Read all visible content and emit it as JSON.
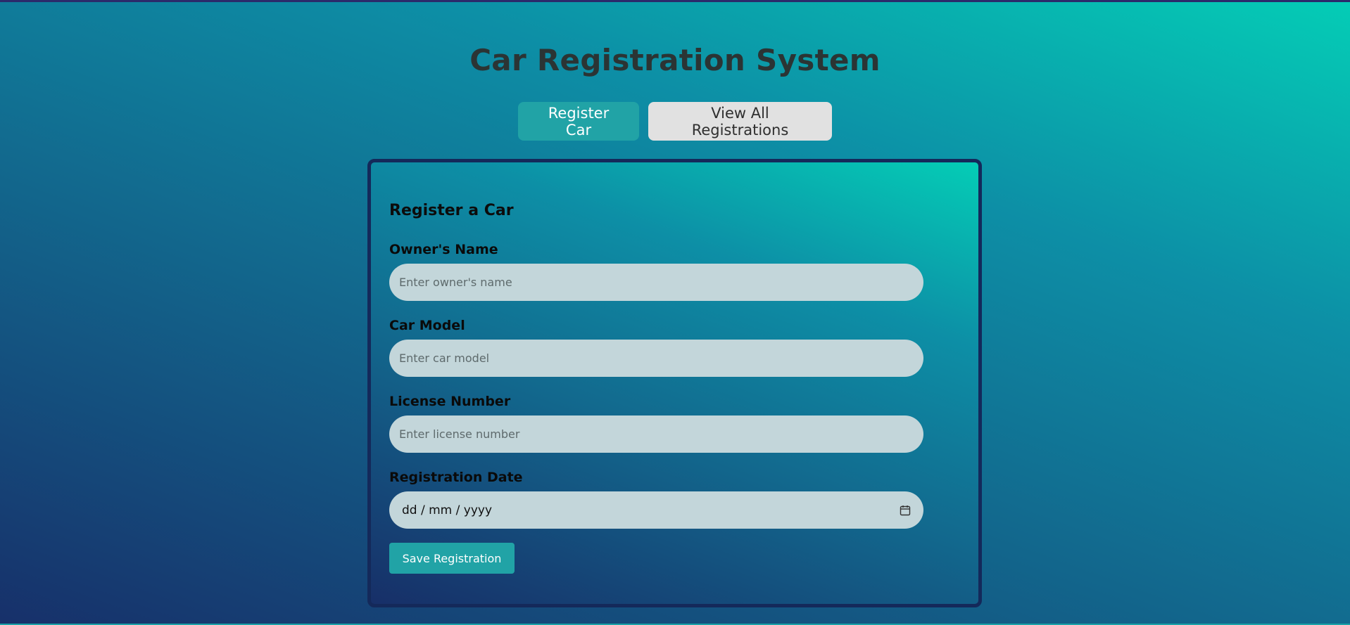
{
  "page": {
    "title": "Car Registration System"
  },
  "nav": {
    "register_label": "Register Car",
    "view_label": "View All Registrations"
  },
  "form": {
    "title": "Register a Car",
    "owner": {
      "label": "Owner's Name",
      "placeholder": "Enter owner's name"
    },
    "model": {
      "label": "Car Model",
      "placeholder": "Enter car model"
    },
    "license": {
      "label": "License Number",
      "placeholder": "Enter license number"
    },
    "date": {
      "label": "Registration Date",
      "placeholder": "dd / mm / yyyy",
      "icon": "calendar-icon"
    },
    "save_label": "Save Registration"
  },
  "colors": {
    "accent": "#21a3a6",
    "input_bg": "#c3d6da",
    "card_border": "#14295a"
  }
}
